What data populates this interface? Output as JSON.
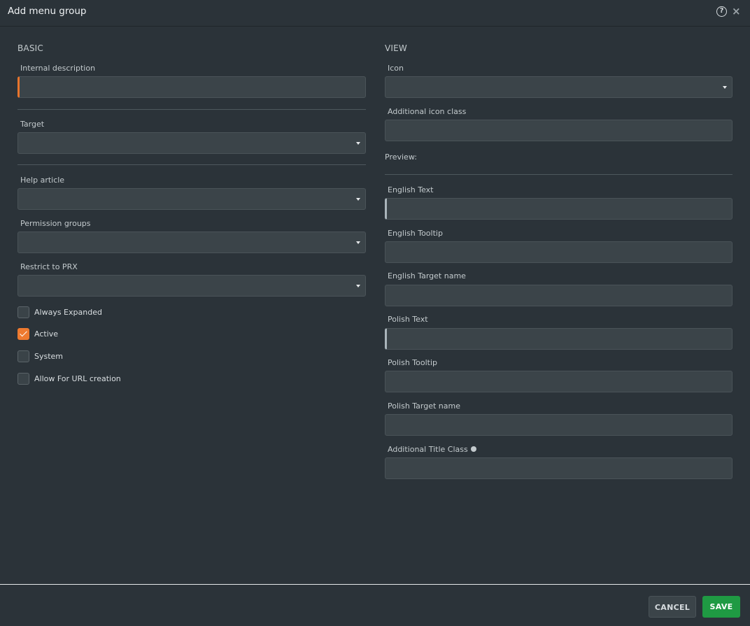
{
  "header": {
    "title": "Add menu group",
    "help_icon": "question-circle-icon",
    "close_icon": "close-icon",
    "help_glyph": "?",
    "close_glyph": "×"
  },
  "basic": {
    "title": "BASIC",
    "internal_description": {
      "label": "Internal description",
      "value": ""
    },
    "target": {
      "label": "Target",
      "value": ""
    },
    "help_article": {
      "label": "Help article",
      "value": ""
    },
    "permission_groups": {
      "label": "Permission groups",
      "value": ""
    },
    "restrict_to_prx": {
      "label": "Restrict to PRX",
      "value": ""
    },
    "checkboxes": [
      {
        "label": "Always Expanded",
        "checked": false
      },
      {
        "label": "Active",
        "checked": true
      },
      {
        "label": "System",
        "checked": false
      },
      {
        "label": "Allow For URL creation",
        "checked": false
      }
    ]
  },
  "view": {
    "title": "VIEW",
    "icon": {
      "label": "Icon",
      "value": ""
    },
    "additional_icon_class": {
      "label": "Additional icon class",
      "value": ""
    },
    "preview_label": "Preview:",
    "english_text": {
      "label": "English Text",
      "value": ""
    },
    "english_tooltip": {
      "label": "English Tooltip",
      "value": ""
    },
    "english_target_name": {
      "label": "English Target name",
      "value": ""
    },
    "polish_text": {
      "label": "Polish Text",
      "value": ""
    },
    "polish_tooltip": {
      "label": "Polish Tooltip",
      "value": ""
    },
    "polish_target_name": {
      "label": "Polish Target name",
      "value": ""
    },
    "additional_title_class": {
      "label": "Additional Title Class",
      "value": ""
    }
  },
  "footer": {
    "cancel_label": "CANCEL",
    "save_label": "SAVE"
  },
  "colors": {
    "accent": "#ee7a2f",
    "save": "#1f9a43",
    "background": "#2b3339",
    "field": "#3b4449"
  }
}
